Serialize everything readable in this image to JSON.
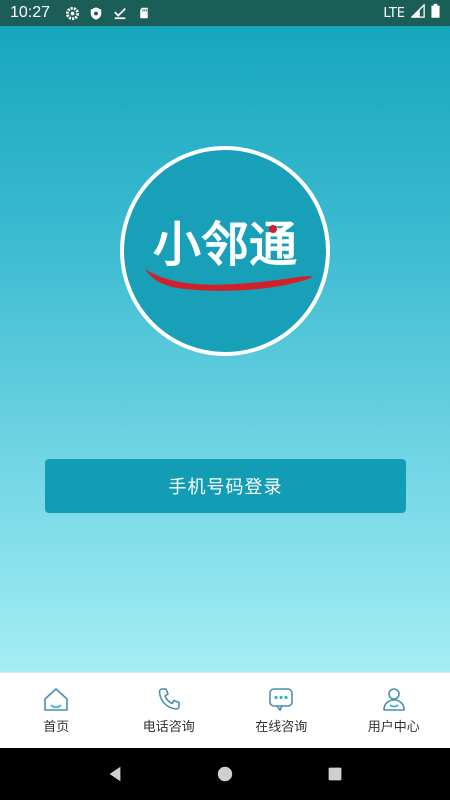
{
  "status_bar": {
    "time": "10:27",
    "network": "LTE",
    "icons": [
      "settings-icon",
      "shield-icon",
      "download-done-icon",
      "sd-card-icon",
      "signal-icon",
      "battery-icon"
    ]
  },
  "logo": {
    "text": "小邻通",
    "colors": {
      "circle": "#18a0b8",
      "border": "#ffffff",
      "swoosh": "#d0202a"
    }
  },
  "login": {
    "button_label": "手机号码登录",
    "color": "#129db4"
  },
  "tabbar": {
    "items": [
      {
        "label": "首页",
        "icon": "home-icon"
      },
      {
        "label": "电话咨询",
        "icon": "phone-icon"
      },
      {
        "label": "在线咨询",
        "icon": "chat-icon"
      },
      {
        "label": "用户中心",
        "icon": "user-icon"
      }
    ]
  },
  "nav": {
    "icons": [
      "back-icon",
      "home-circle-icon",
      "recents-icon"
    ]
  }
}
